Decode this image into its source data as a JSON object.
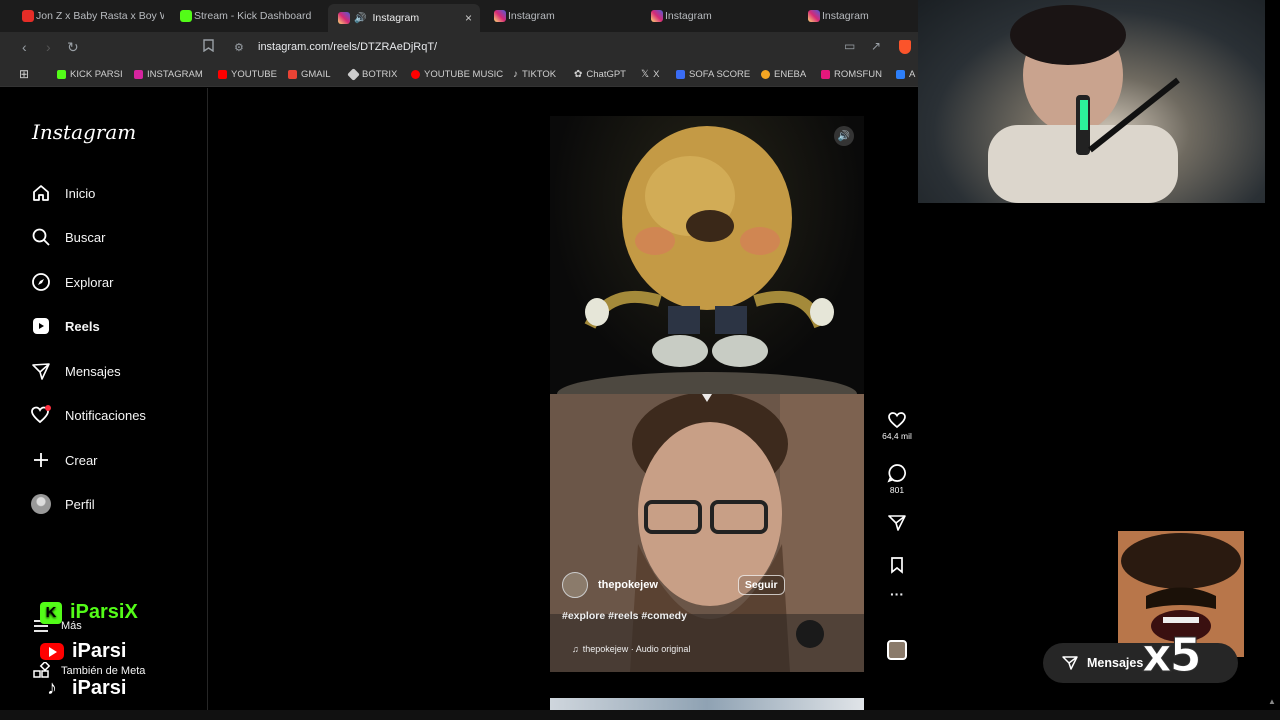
{
  "browser": {
    "tabs": [
      {
        "title": "Jon Z x Baby Rasta x Boy W...",
        "color": "#e52d27",
        "active": false
      },
      {
        "title": "Stream - Kick Dashboard",
        "color": "#53fc18",
        "active": false
      },
      {
        "title": "Instagram",
        "color": "#d6249f",
        "active": true,
        "close": "×"
      },
      {
        "title": "Instagram",
        "color": "#d6249f",
        "active": false
      },
      {
        "title": "Instagram",
        "color": "#d6249f",
        "active": false
      },
      {
        "title": "Instagram",
        "color": "#d6249f",
        "active": false
      }
    ],
    "url": "instagram.com/reels/DTZRAeDjRqT/",
    "bookmarks": [
      {
        "label": "KICK PARSI",
        "color": "#53fc18"
      },
      {
        "label": "INSTAGRAM",
        "color": "#d6249f"
      },
      {
        "label": "YOUTUBE",
        "color": "#ff0000"
      },
      {
        "label": "GMAIL",
        "color": "#ea4335"
      },
      {
        "label": "BOTRIX",
        "color": "#cccccc"
      },
      {
        "label": "YOUTUBE MUSIC",
        "color": "#ff0000"
      },
      {
        "label": "TIKTOK",
        "color": "#ffffff"
      },
      {
        "label": "ChatGPT",
        "color": "#aaaaaa"
      },
      {
        "label": "X",
        "color": "#ffffff"
      },
      {
        "label": "SOFA SCORE",
        "color": "#3a6cf4"
      },
      {
        "label": "ENEBA",
        "color": "#f5a623"
      },
      {
        "label": "ROMSFUN",
        "color": "#e5177b"
      },
      {
        "label": "A",
        "color": "#2d7ff9"
      }
    ]
  },
  "instagram": {
    "logo": "Instagram",
    "nav": [
      {
        "label": "Inicio",
        "icon": "home-icon"
      },
      {
        "label": "Buscar",
        "icon": "search-icon"
      },
      {
        "label": "Explorar",
        "icon": "compass-icon"
      },
      {
        "label": "Reels",
        "icon": "reels-icon",
        "active": true
      },
      {
        "label": "Mensajes",
        "icon": "messenger-icon"
      },
      {
        "label": "Notificaciones",
        "icon": "heart-icon"
      },
      {
        "label": "Crear",
        "icon": "plus-icon"
      },
      {
        "label": "Perfil",
        "icon": "avatar"
      }
    ],
    "more_label": "Más",
    "meta_label": "También de Meta",
    "reel": {
      "username": "thepokejew",
      "follow_label": "Seguir",
      "hashtags": "#explore #reels #comedy",
      "audio": "thepokejew · Audio original",
      "likes": "64,4 mil",
      "comments": "801"
    },
    "messages_button": "Mensajes"
  },
  "overlay": {
    "kick_handle": "iParsiX",
    "youtube_handle": "iParsi",
    "tiktok_handle": "iParsi",
    "multiplier": "x5"
  }
}
